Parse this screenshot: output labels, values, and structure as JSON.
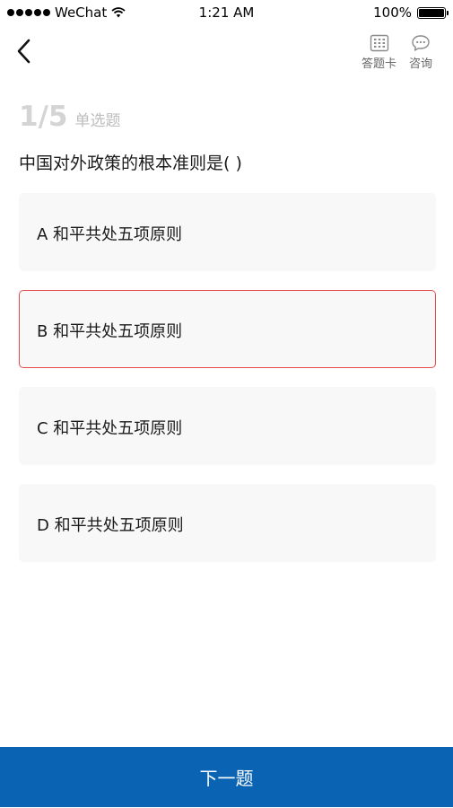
{
  "status_bar": {
    "carrier": "WeChat",
    "time": "1:21 AM",
    "battery": "100%",
    "battery_level": 1.0
  },
  "nav": {
    "back_icon": "chevron-left-icon",
    "answer_card_label": "答题卡",
    "answer_card_icon": "grid-card-icon",
    "consult_label": "咨询",
    "consult_icon": "chat-bubble-icon"
  },
  "progress": {
    "counter": "1/5",
    "question_type": "单选题"
  },
  "question": {
    "text": "中国对外政策的根本准则是( )"
  },
  "options": [
    {
      "label": "A 和平共处五项原则",
      "selected": false
    },
    {
      "label": "B 和平共处五项原则",
      "selected": true
    },
    {
      "label": "C 和平共处五项原则",
      "selected": false
    },
    {
      "label": "D 和平共处五项原则",
      "selected": false
    }
  ],
  "footer": {
    "next_label": "下一题"
  },
  "colors": {
    "accent": "#0b63b3",
    "selected_border": "#e64b4b",
    "option_bg": "#f8f8f8"
  }
}
